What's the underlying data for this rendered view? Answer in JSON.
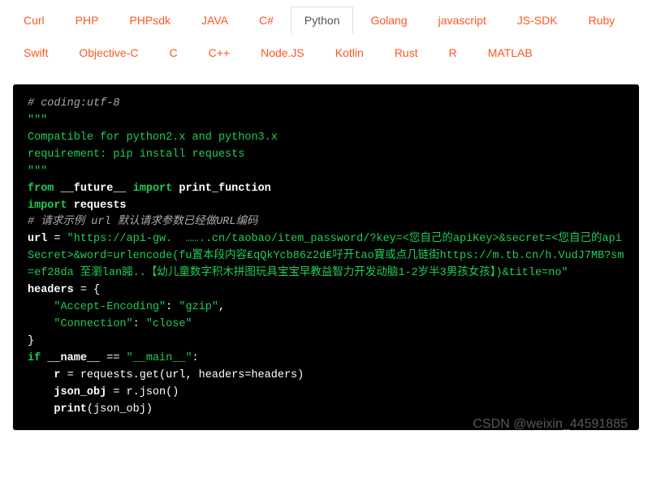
{
  "tabs": {
    "row1": [
      "Curl",
      "PHP",
      "PHPsdk",
      "JAVA",
      "C#",
      "Python",
      "Golang",
      "javascript",
      "JS-SDK",
      "Ruby"
    ],
    "row2": [
      "Swift",
      "Objective-C",
      "C",
      "C++",
      "Node.JS",
      "Kotlin",
      "Rust",
      "R",
      "MATLAB"
    ],
    "active": "Python"
  },
  "code": {
    "coding_comment": "# coding:utf-8",
    "docstring_open": "\"\"\"",
    "doc_line1": "Compatible for python2.x and python3.x",
    "doc_line2": "requirement: pip install requests",
    "docstring_close": "\"\"\"",
    "from_kw": "from",
    "future_mod": "__future__",
    "import_kw": "import",
    "print_function": "print_function",
    "import_kw2": "import",
    "requests_mod": "requests",
    "url_comment": "# 请求示例 url 默认请求参数已经做URL编码",
    "url_var": "url",
    "eq": " = ",
    "url_value": "\"https://api-gw.  ……..cn/taobao/item_password/?key=<您自己的apiKey>&secret=<您自己的apiSecret>&word=urlencode(fu置本段内容₤qQkYcb86z2d₤吇开tao寶或点几链街https://m.tb.cn/h.VudJ7MB?sm=ef28da 至瀏lan嘂..【幼儿童数字积木拼图玩具宝宝早教益智力开发动脑1-2岁半3男孩女孩】)&title=no\"",
    "headers_var": "headers",
    "headers_open": " = {",
    "header1_key": "\"Accept-Encoding\"",
    "header1_sep": ": ",
    "header1_val": "\"gzip\"",
    "header1_comma": ",",
    "header2_key": "\"Connection\"",
    "header2_sep": ": ",
    "header2_val": "\"close\"",
    "headers_close": "}",
    "if_kw": "if",
    "name_dunder": "__name__",
    "eqeq": " == ",
    "main_str": "\"__main__\"",
    "colon": ":",
    "r_var": "r",
    "req_get": " = requests.get(url, headers=headers)",
    "json_obj": "json_obj",
    "r_json": " = r.json()",
    "print_call": "print",
    "print_arg": "(json_obj)"
  },
  "watermark": "CSDN @weixin_44591885"
}
